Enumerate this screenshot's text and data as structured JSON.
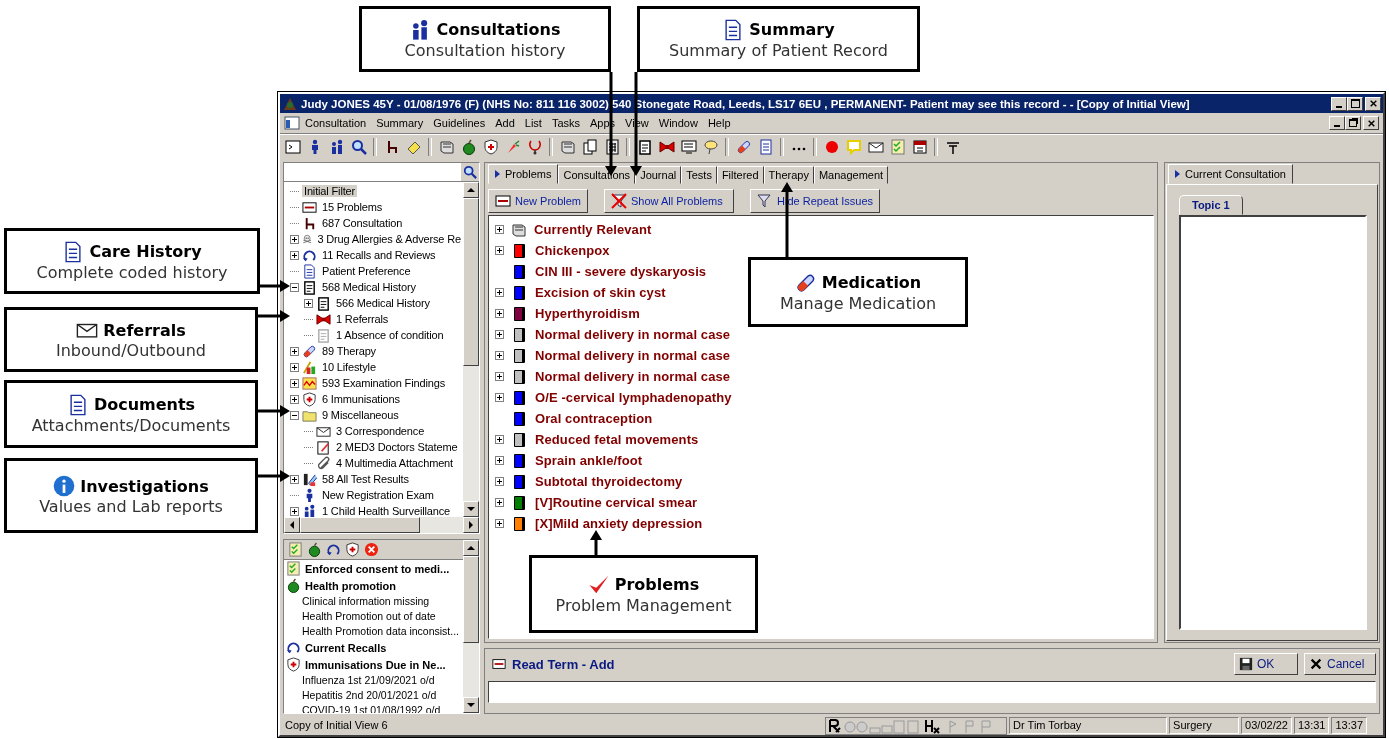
{
  "callouts": [
    {
      "title": "Consultations",
      "subtitle": "Consultation history"
    },
    {
      "title": "Summary",
      "subtitle": "Summary of Patient Record"
    },
    {
      "title": "Care History",
      "subtitle": "Complete coded history"
    },
    {
      "title": "Referrals",
      "subtitle": "Inbound/Outbound"
    },
    {
      "title": "Documents",
      "subtitle": "Attachments/Documents"
    },
    {
      "title": "Investigations",
      "subtitle": "Values and Lab reports"
    },
    {
      "title": "Medication",
      "subtitle": "Manage Medication"
    },
    {
      "title": "Problems",
      "subtitle": "Problem Management"
    }
  ],
  "window": {
    "title": "Judy JONES 45Y - 01/08/1976 (F) (NHS No: 811 116 3002)  540 Stonegate Road, Leeds, LS17 6EU , PERMANENT- Patient may see this record - - [Copy of Initial View]",
    "menu": [
      "Consultation",
      "Summary",
      "Guidelines",
      "Add",
      "List",
      "Tasks",
      "Apps",
      "View",
      "Window",
      "Help"
    ]
  },
  "tree": [
    {
      "label": "Initial Filter",
      "kind": "filter",
      "expandable": false,
      "selected": true
    },
    {
      "label": "15 Problems",
      "kind": "problems",
      "expandable": false,
      "selected": false
    },
    {
      "label": "687 Consultation",
      "kind": "consultation",
      "expandable": false,
      "selected": false
    },
    {
      "label": "3 Drug Allergies & Adverse Re",
      "kind": "allergy",
      "expandable": true,
      "expanded": false,
      "selected": false
    },
    {
      "label": "11 Recalls and Reviews",
      "kind": "recall",
      "expandable": true,
      "expanded": false,
      "selected": false
    },
    {
      "label": "Patient Preference",
      "kind": "preference",
      "expandable": false,
      "selected": false
    },
    {
      "label": "568 Medical History",
      "kind": "history",
      "expandable": true,
      "expanded": true,
      "selected": false,
      "children": [
        {
          "label": "566 Medical History",
          "kind": "history",
          "expandable": true,
          "expanded": false,
          "selected": false
        },
        {
          "label": "1 Referrals",
          "kind": "referral",
          "expandable": false,
          "selected": false
        },
        {
          "label": "1 Absence of condition",
          "kind": "absence",
          "expandable": false,
          "selected": false
        }
      ]
    },
    {
      "label": "89 Therapy",
      "kind": "therapy",
      "expandable": true,
      "expanded": false,
      "selected": false
    },
    {
      "label": "10 Lifestyle",
      "kind": "lifestyle",
      "expandable": true,
      "expanded": false,
      "selected": false
    },
    {
      "label": "593 Examination Findings",
      "kind": "examination",
      "expandable": true,
      "expanded": false,
      "selected": false
    },
    {
      "label": "6 Immunisations",
      "kind": "immunisation",
      "expandable": true,
      "expanded": false,
      "selected": false
    },
    {
      "label": "9 Miscellaneous",
      "kind": "misc",
      "expandable": true,
      "expanded": true,
      "selected": false,
      "children": [
        {
          "label": "3 Correspondence",
          "kind": "correspondence",
          "expandable": false,
          "selected": false
        },
        {
          "label": "2 MED3 Doctors Stateme",
          "kind": "med3",
          "expandable": false,
          "selected": false
        },
        {
          "label": "4 Multimedia Attachment",
          "kind": "multimedia",
          "expandable": false,
          "selected": false
        }
      ]
    },
    {
      "label": "58 All Test Results",
      "kind": "tests",
      "expandable": true,
      "expanded": false,
      "selected": false
    },
    {
      "label": "New Registration Exam",
      "kind": "registration",
      "expandable": false,
      "selected": false
    },
    {
      "label": "1 Child Health Surveillance",
      "kind": "child",
      "expandable": true,
      "expanded": false,
      "selected": false
    }
  ],
  "alerts": [
    {
      "kind": "consent",
      "label": "Enforced consent to medi..."
    },
    {
      "kind": "promotion",
      "label": "Health promotion"
    },
    {
      "kind": "line",
      "label": "Clinical information missing"
    },
    {
      "kind": "line",
      "label": "Health Promotion out of date"
    },
    {
      "kind": "line",
      "label": "Health Promotion data inconsist..."
    },
    {
      "kind": "recall",
      "label": "Current Recalls"
    },
    {
      "kind": "immunisation",
      "label": "Immunisations Due in Ne..."
    },
    {
      "kind": "line",
      "label": "Influenza 1st 21/09/2021  o/d"
    },
    {
      "kind": "line",
      "label": "Hepatitis 2nd 20/01/2021  o/d"
    },
    {
      "kind": "line",
      "label": "COVID-19 1st 01/08/1992  o/d"
    }
  ],
  "tabs": [
    {
      "label": "Problems",
      "selected": true
    },
    {
      "label": "Consultations",
      "selected": false
    },
    {
      "label": "Journal",
      "selected": false
    },
    {
      "label": "Tests",
      "selected": false
    },
    {
      "label": "Filtered",
      "selected": false
    },
    {
      "label": "Therapy",
      "selected": false
    },
    {
      "label": "Management",
      "selected": false
    }
  ],
  "problem_buttons": [
    "New Problem",
    "Show All Problems",
    "Hide Repeat Issues"
  ],
  "problems": [
    {
      "kind": "group",
      "label": "Currently Relevant",
      "expander": true
    },
    {
      "kind": "problem",
      "label": "Chickenpox",
      "color": "#ff0000",
      "expander": true
    },
    {
      "kind": "problem",
      "label": "CIN III - severe dyskaryosis",
      "color": "#0000ff",
      "expander": false
    },
    {
      "kind": "problem",
      "label": "Excision of skin cyst",
      "color": "#0000ff",
      "expander": true
    },
    {
      "kind": "problem",
      "label": "Hyperthyroidism",
      "color": "#800040",
      "expander": true
    },
    {
      "kind": "problem",
      "label": "Normal delivery in normal case",
      "color": "#c0c0c0",
      "expander": true
    },
    {
      "kind": "problem",
      "label": "Normal delivery in normal case",
      "color": "#c0c0c0",
      "expander": true
    },
    {
      "kind": "problem",
      "label": "Normal delivery in normal case",
      "color": "#c0c0c0",
      "expander": true
    },
    {
      "kind": "problem",
      "label": "O/E -cervical lymphadenopathy",
      "color": "#0000ff",
      "expander": true
    },
    {
      "kind": "problem",
      "label": "Oral contraception",
      "color": "#0000ff",
      "expander": false
    },
    {
      "kind": "problem",
      "label": "Reduced fetal movements",
      "color": "#c0c0c0",
      "expander": true
    },
    {
      "kind": "problem",
      "label": "Sprain ankle/foot",
      "color": "#0000ff",
      "expander": true
    },
    {
      "kind": "problem",
      "label": "Subtotal thyroidectomy",
      "color": "#0000ff",
      "expander": true
    },
    {
      "kind": "problem",
      "label": "[V]Routine cervical smear",
      "color": "#008000",
      "expander": true
    },
    {
      "kind": "problem",
      "label": "[X]Mild anxiety depression",
      "color": "#ff8000",
      "expander": true
    }
  ],
  "consultation_tabs": [
    {
      "label": "Current Consultation",
      "selected": true
    }
  ],
  "topic_tabs": [
    {
      "label": "Topic 1",
      "selected": true
    }
  ],
  "read_term": {
    "title": "Read Term - Add",
    "buttons": [
      "OK",
      "Cancel"
    ]
  },
  "status_bar": {
    "view": "Copy of Initial View 6",
    "user": "Dr Tim Torbay",
    "location": "Surgery",
    "date": "03/02/22",
    "time_1": "13:31",
    "time_2": "13:37"
  }
}
